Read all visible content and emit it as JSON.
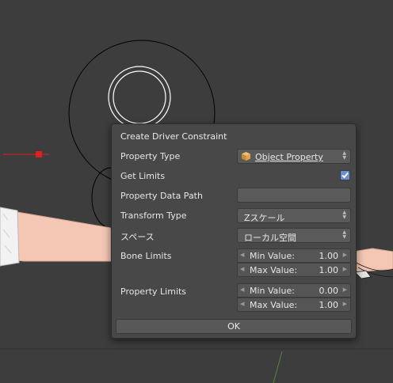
{
  "dialog": {
    "title": "Create Driver Constraint",
    "property_type": {
      "label": "Property Type",
      "value": "Object Property",
      "icon": "cube-icon"
    },
    "get_limits": {
      "label": "Get Limits",
      "checked": true
    },
    "property_data_path": {
      "label": "Property Data Path",
      "value": ""
    },
    "transform_type": {
      "label": "Transform Type",
      "value": "Zスケール"
    },
    "space": {
      "label": "スペース",
      "value": "ローカル空間"
    },
    "bone_limits": {
      "label": "Bone Limits",
      "min": {
        "label": "Min Value:",
        "value": "1.00"
      },
      "max": {
        "label": "Max Value:",
        "value": "1.00"
      }
    },
    "property_limits": {
      "label": "Property Limits",
      "min": {
        "label": "Min Value:",
        "value": "0.00"
      },
      "max": {
        "label": "Max Value:",
        "value": "1.00"
      }
    },
    "ok_label": "OK"
  },
  "colors": {
    "viewport_bg": "#3d3d3d",
    "dialog_bg": "#484848",
    "field_bg": "#5a5a5a",
    "checkbox_accent": "#6e8fc6",
    "selection_red": "#e0201f",
    "mesh_skin": "#f3c7b4"
  }
}
